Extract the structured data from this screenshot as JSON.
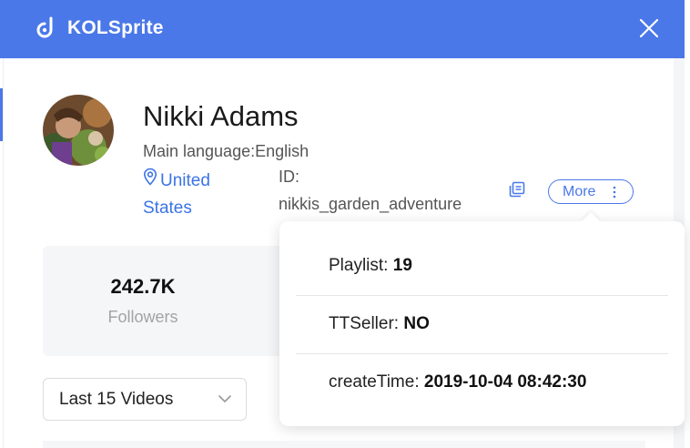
{
  "app": {
    "title": "KOLSprite",
    "accent_color": "#4a78e8"
  },
  "profile": {
    "name": "Nikki Adams",
    "main_language": "Main language:English",
    "location_line1": "United",
    "location_line2": "States",
    "id_label": "ID:",
    "id_value": "nikkis_garden_adventure",
    "more_label": "More"
  },
  "stats": {
    "followers_value": "242.7K",
    "followers_label": "Followers"
  },
  "video_filter": {
    "selected": "Last 15 Videos"
  },
  "more_popover": {
    "rows": [
      {
        "label": "Playlist: ",
        "value": "19"
      },
      {
        "label": "TTSeller: ",
        "value": "NO"
      },
      {
        "label": "createTime: ",
        "value": "2019-10-04 08:42:30"
      }
    ]
  },
  "icons": {
    "logo": "kolsprite-logo-icon",
    "close": "close-icon",
    "location": "location-pin-icon",
    "copy": "copy-icon",
    "more": "vertical-dots-icon",
    "dropdown": "chevron-down-icon"
  }
}
